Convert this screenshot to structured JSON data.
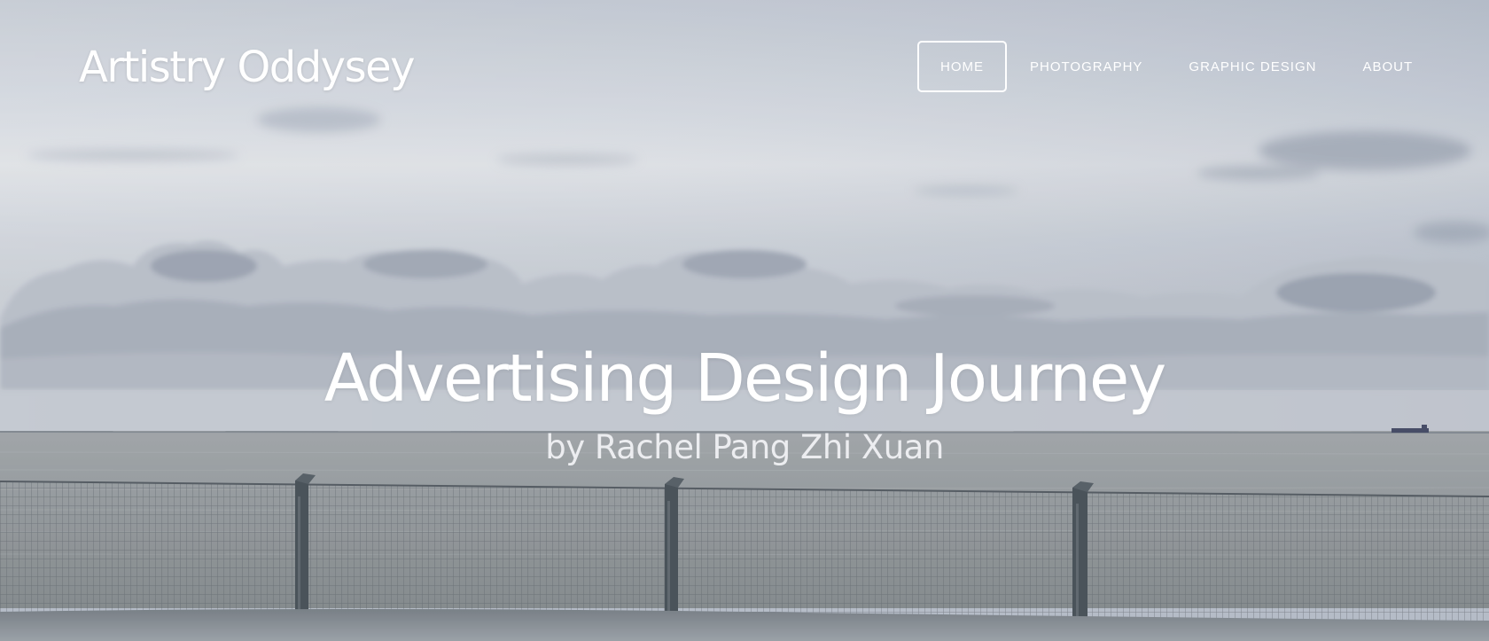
{
  "site": {
    "title": "Artistry Oddysey"
  },
  "nav": {
    "items": [
      {
        "label": "HOME",
        "active": true
      },
      {
        "label": "PHOTOGRAPHY",
        "active": false
      },
      {
        "label": "GRAPHIC DESIGN",
        "active": false
      },
      {
        "label": "ABOUT",
        "active": false
      }
    ]
  },
  "hero": {
    "headline": "Advertising Design Journey",
    "byline": "by Rachel Pang Zhi Xuan",
    "background": "overcast-sea-with-fence-photo"
  },
  "colors": {
    "text": "#ffffff",
    "sky": "#c6ccd6",
    "sea": "#9ea3a6",
    "fence": "#4a5158"
  }
}
